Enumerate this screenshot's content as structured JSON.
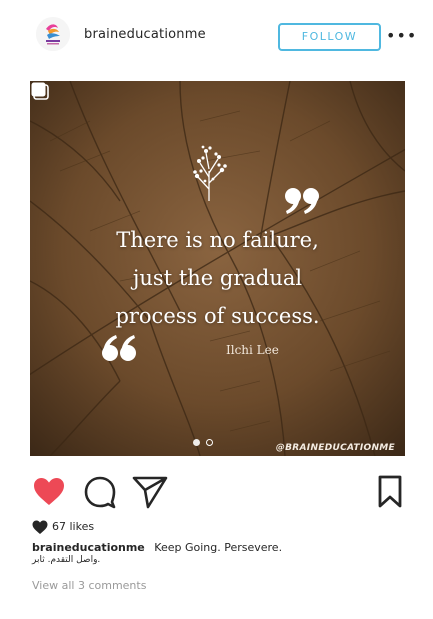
{
  "header": {
    "username": "braineducationme",
    "follow_label": "FOLLOW",
    "more_label": "•••"
  },
  "post": {
    "quote_lines": [
      "There is no failure,",
      "just the gradual",
      "process of success."
    ],
    "author": "Ilchi Lee",
    "watermark": "@BRAINEDUCATIONME",
    "carousel_count": 2,
    "carousel_active": 0
  },
  "actions": {
    "like_icon": "heart-icon",
    "comment_icon": "comment-icon",
    "share_icon": "send-icon",
    "save_icon": "bookmark-icon"
  },
  "likes": {
    "text": "67 likes"
  },
  "caption": {
    "username": "braineducationme",
    "text": "Keep Going. Persevere.",
    "arabic_text": "واصل التقدم. ثابر."
  },
  "comments": {
    "view_all_label": "View all 3 comments"
  },
  "colors": {
    "accent": "#4fb8e0",
    "like_red": "#ed4956",
    "post_brown": "#6a4a2a"
  }
}
